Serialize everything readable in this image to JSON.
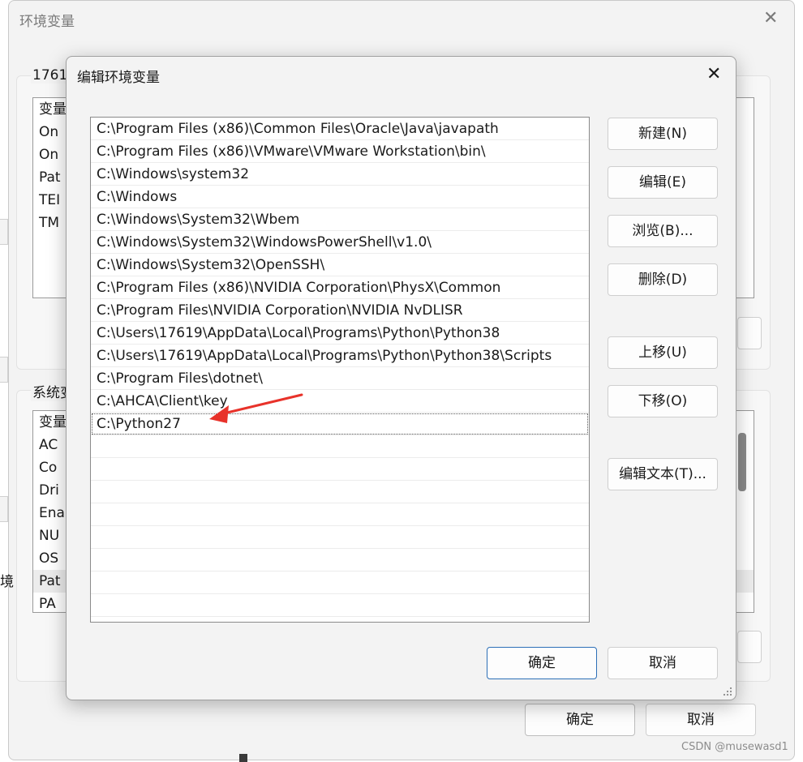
{
  "background_window": {
    "title": "环境变量",
    "close_glyph": "✕",
    "user_group_label": "1761",
    "user_list_partial": [
      "变量",
      "On",
      "On",
      "Pat",
      "TEI",
      "TM"
    ],
    "system_group_label": "系统变",
    "system_list_partial": [
      "变量",
      "AC",
      "Co",
      "Dri",
      "Ena",
      "NU",
      "OS",
      "Pat",
      "PA"
    ],
    "left_edge_char": "境",
    "ok_label": "确定",
    "cancel_label": "取消"
  },
  "dialog": {
    "title": "编辑环境变量",
    "close_glyph": "✕",
    "paths": [
      "C:\\Program Files (x86)\\Common Files\\Oracle\\Java\\javapath",
      "C:\\Program Files (x86)\\VMware\\VMware Workstation\\bin\\",
      "C:\\Windows\\system32",
      "C:\\Windows",
      "C:\\Windows\\System32\\Wbem",
      "C:\\Windows\\System32\\WindowsPowerShell\\v1.0\\",
      "C:\\Windows\\System32\\OpenSSH\\",
      "C:\\Program Files (x86)\\NVIDIA Corporation\\PhysX\\Common",
      "C:\\Program Files\\NVIDIA Corporation\\NVIDIA NvDLISR",
      "C:\\Users\\17619\\AppData\\Local\\Programs\\Python\\Python38",
      "C:\\Users\\17619\\AppData\\Local\\Programs\\Python\\Python38\\Scripts",
      "C:\\Program Files\\dotnet\\",
      "C:\\AHCA\\Client\\key",
      "C:\\Python27"
    ],
    "buttons": {
      "new": "新建(N)",
      "edit": "编辑(E)",
      "browse": "浏览(B)...",
      "delete": "删除(D)",
      "move_up": "上移(U)",
      "move_down": "下移(O)",
      "edit_text": "编辑文本(T)..."
    },
    "ok_label": "确定",
    "cancel_label": "取消",
    "accent_color": "#2d6fb7",
    "annotation_arrow_color": "#e8322a"
  },
  "watermark": "CSDN @musewasd1"
}
